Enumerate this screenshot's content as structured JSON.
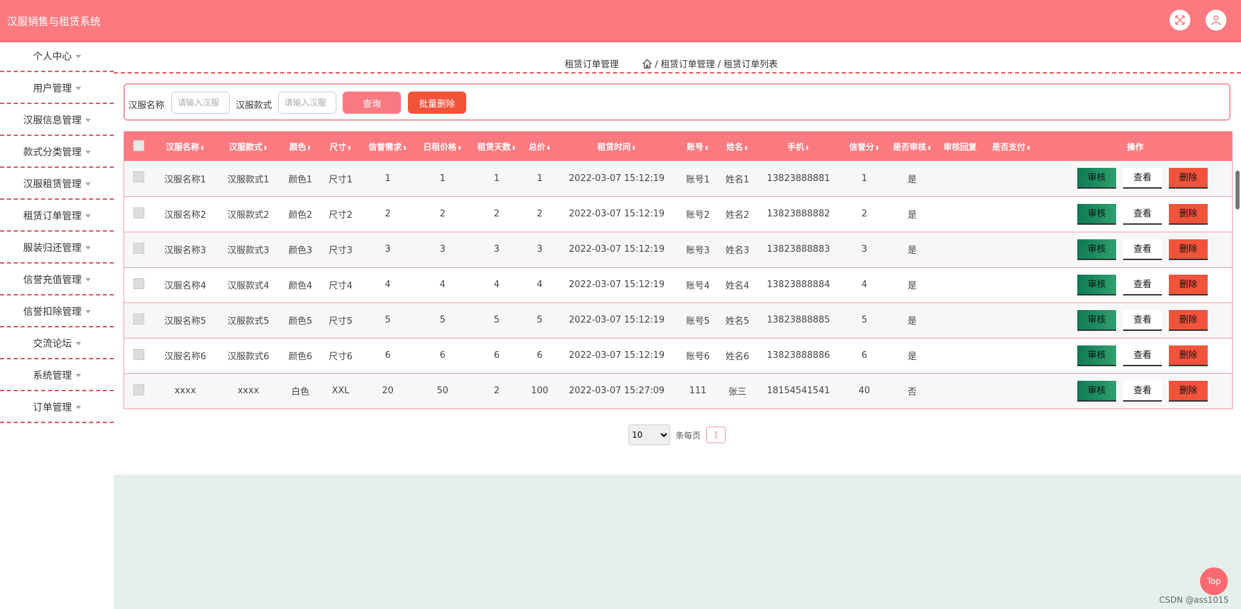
{
  "app": {
    "title": "汉服销售与租赁系统"
  },
  "header_icons": [
    "fullscreen-icon",
    "user-icon"
  ],
  "sidebar": {
    "items": [
      {
        "label": "个人中心"
      },
      {
        "label": "用户管理"
      },
      {
        "label": "汉服信息管理"
      },
      {
        "label": "款式分类管理"
      },
      {
        "label": "汉服租赁管理"
      },
      {
        "label": "租赁订单管理"
      },
      {
        "label": "服装归还管理"
      },
      {
        "label": "信誉充值管理"
      },
      {
        "label": "信誉扣除管理"
      },
      {
        "label": "交流论坛"
      },
      {
        "label": "系统管理"
      },
      {
        "label": "订单管理"
      }
    ]
  },
  "breadcrumb": {
    "section": "租赁订单管理",
    "path": "/ 租赁订单管理 / 租赁订单列表"
  },
  "search": {
    "name_label": "汉服名称",
    "name_placeholder": "请输入汉服",
    "style_label": "汉服款式",
    "style_placeholder": "请输入汉服",
    "query_button": "查询",
    "batch_delete_button": "批量删除"
  },
  "table": {
    "columns": [
      "汉服名称",
      "汉服款式",
      "颜色",
      "尺寸",
      "信誉需求",
      "日租价格",
      "租赁天数",
      "总价",
      "租赁时间",
      "账号",
      "姓名",
      "手机",
      "信誉分",
      "是否审核",
      "审核回复",
      "是否支付",
      "操作"
    ],
    "rows": [
      [
        "汉服名称1",
        "汉服款式1",
        "颜色1",
        "尺寸1",
        "1",
        "1",
        "1",
        "1",
        "2022-03-07 15:12:19",
        "账号1",
        "姓名1",
        "13823888881",
        "1",
        "是",
        "",
        ""
      ],
      [
        "汉服名称2",
        "汉服款式2",
        "颜色2",
        "尺寸2",
        "2",
        "2",
        "2",
        "2",
        "2022-03-07 15:12:19",
        "账号2",
        "姓名2",
        "13823888882",
        "2",
        "是",
        "",
        ""
      ],
      [
        "汉服名称3",
        "汉服款式3",
        "颜色3",
        "尺寸3",
        "3",
        "3",
        "3",
        "3",
        "2022-03-07 15:12:19",
        "账号3",
        "姓名3",
        "13823888883",
        "3",
        "是",
        "",
        ""
      ],
      [
        "汉服名称4",
        "汉服款式4",
        "颜色4",
        "尺寸4",
        "4",
        "4",
        "4",
        "4",
        "2022-03-07 15:12:19",
        "账号4",
        "姓名4",
        "13823888884",
        "4",
        "是",
        "",
        ""
      ],
      [
        "汉服名称5",
        "汉服款式5",
        "颜色5",
        "尺寸5",
        "5",
        "5",
        "5",
        "5",
        "2022-03-07 15:12:19",
        "账号5",
        "姓名5",
        "13823888885",
        "5",
        "是",
        "",
        ""
      ],
      [
        "汉服名称6",
        "汉服款式6",
        "颜色6",
        "尺寸6",
        "6",
        "6",
        "6",
        "6",
        "2022-03-07 15:12:19",
        "账号6",
        "姓名6",
        "13823888886",
        "6",
        "是",
        "",
        ""
      ],
      [
        "xxxx",
        "xxxx",
        "白色",
        "XXL",
        "20",
        "50",
        "2",
        "100",
        "2022-03-07 15:27:09",
        "111",
        "张三",
        "18154541541",
        "40",
        "否",
        "",
        ""
      ]
    ],
    "actions": {
      "audit": "审核",
      "view": "查看",
      "delete": "删除"
    }
  },
  "pagination": {
    "page_size": "10",
    "page_size_options": [
      "10"
    ],
    "per_page_label": "条每页",
    "current_page": "1"
  },
  "back_to_top": "Top",
  "watermark": "CSDN @ass1015",
  "colors": {
    "primary": "#fb7a80",
    "danger": "#f2533b",
    "audit": "#1b8a5e",
    "footer_bg": "#e4efec"
  }
}
